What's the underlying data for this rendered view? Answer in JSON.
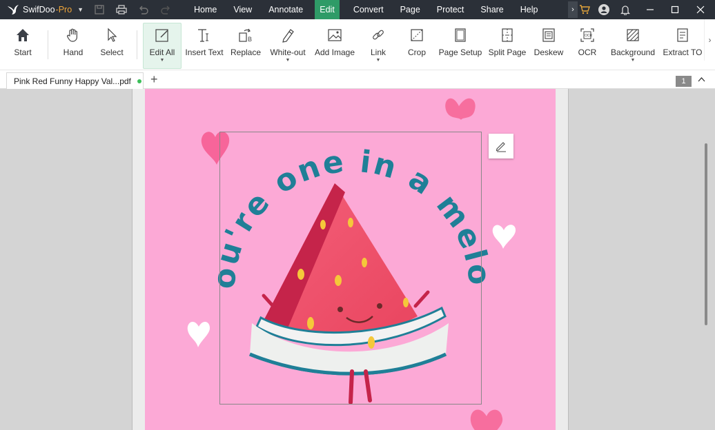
{
  "app": {
    "name": "SwifDoo",
    "edition": "-Pro"
  },
  "menu": [
    "Home",
    "View",
    "Annotate",
    "Edit",
    "Convert",
    "Page",
    "Protect",
    "Share",
    "Help"
  ],
  "active_menu": "Edit",
  "ribbon": {
    "start": "Start",
    "hand": "Hand",
    "select": "Select",
    "edit_all": "Edit All",
    "insert_text": "Insert Text",
    "replace": "Replace",
    "white_out": "White-out",
    "add_image": "Add Image",
    "link": "Link",
    "crop": "Crop",
    "page_setup": "Page Setup",
    "split_page": "Split Page",
    "deskew": "Deskew",
    "ocr": "OCR",
    "background": "Background",
    "extract_toc": "Extract TO"
  },
  "tabs": {
    "document_title": "Pink Red Funny Happy Val...pdf",
    "add_label": "+",
    "page_number": "1"
  },
  "page": {
    "headline": "you're one in a melon"
  },
  "colors": {
    "titlebar": "#2b3038",
    "accent": "#2f9b67",
    "page_bg": "#fca9d6",
    "text_teal": "#1f7f97",
    "heart": "#f76e9e"
  }
}
